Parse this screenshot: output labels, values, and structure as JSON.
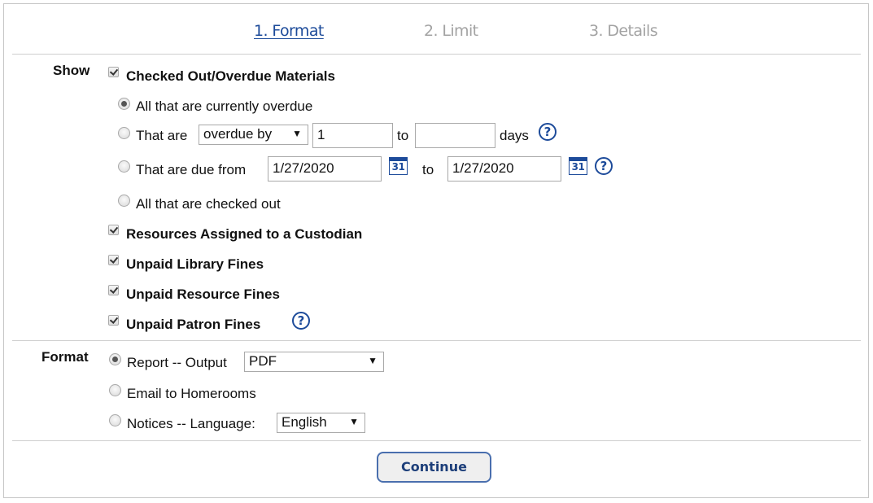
{
  "steps": [
    {
      "label": "1. Format",
      "active": true
    },
    {
      "label": "2. Limit",
      "active": false
    },
    {
      "label": "3. Details",
      "active": false
    }
  ],
  "show": {
    "label": "Show",
    "checked_out": {
      "label": "Checked Out/Overdue Materials",
      "checked": true,
      "options": {
        "currently_overdue": {
          "label": "All that are currently overdue",
          "selected": true
        },
        "overdue_range": {
          "label": "That are",
          "selected": false,
          "mode_select": "overdue by",
          "from_value": "1",
          "to_label": "to",
          "to_value": "",
          "unit_label": "days",
          "help_icon": "help-icon"
        },
        "due_range": {
          "label": "That are due from",
          "selected": false,
          "from_date": "1/27/2020",
          "calendar_icon_text": "31",
          "to_label": "to",
          "to_date": "1/27/2020",
          "help_icon": "help-icon"
        },
        "all_checked_out": {
          "label": "All that are checked out",
          "selected": false
        }
      }
    },
    "custodian": {
      "label": "Resources Assigned to a Custodian",
      "checked": true
    },
    "library_fines": {
      "label": "Unpaid Library Fines",
      "checked": true
    },
    "resource_fines": {
      "label": "Unpaid Resource Fines",
      "checked": true
    },
    "patron_fines": {
      "label": "Unpaid Patron Fines",
      "checked": true,
      "help_icon": "help-icon"
    }
  },
  "format": {
    "label": "Format",
    "report": {
      "label": "Report -- Output",
      "selected": true,
      "output_value": "PDF"
    },
    "email": {
      "label": "Email to Homerooms",
      "selected": false
    },
    "notices": {
      "label": "Notices -- Language:",
      "selected": false,
      "language_value": "English"
    }
  },
  "help_glyph": "?",
  "dropdown_glyph": "▼",
  "continue_label": "Continue",
  "colors": {
    "accent": "#1d4b9a",
    "inactive_step": "#a3a3a3",
    "border": "#c6c6c6"
  }
}
